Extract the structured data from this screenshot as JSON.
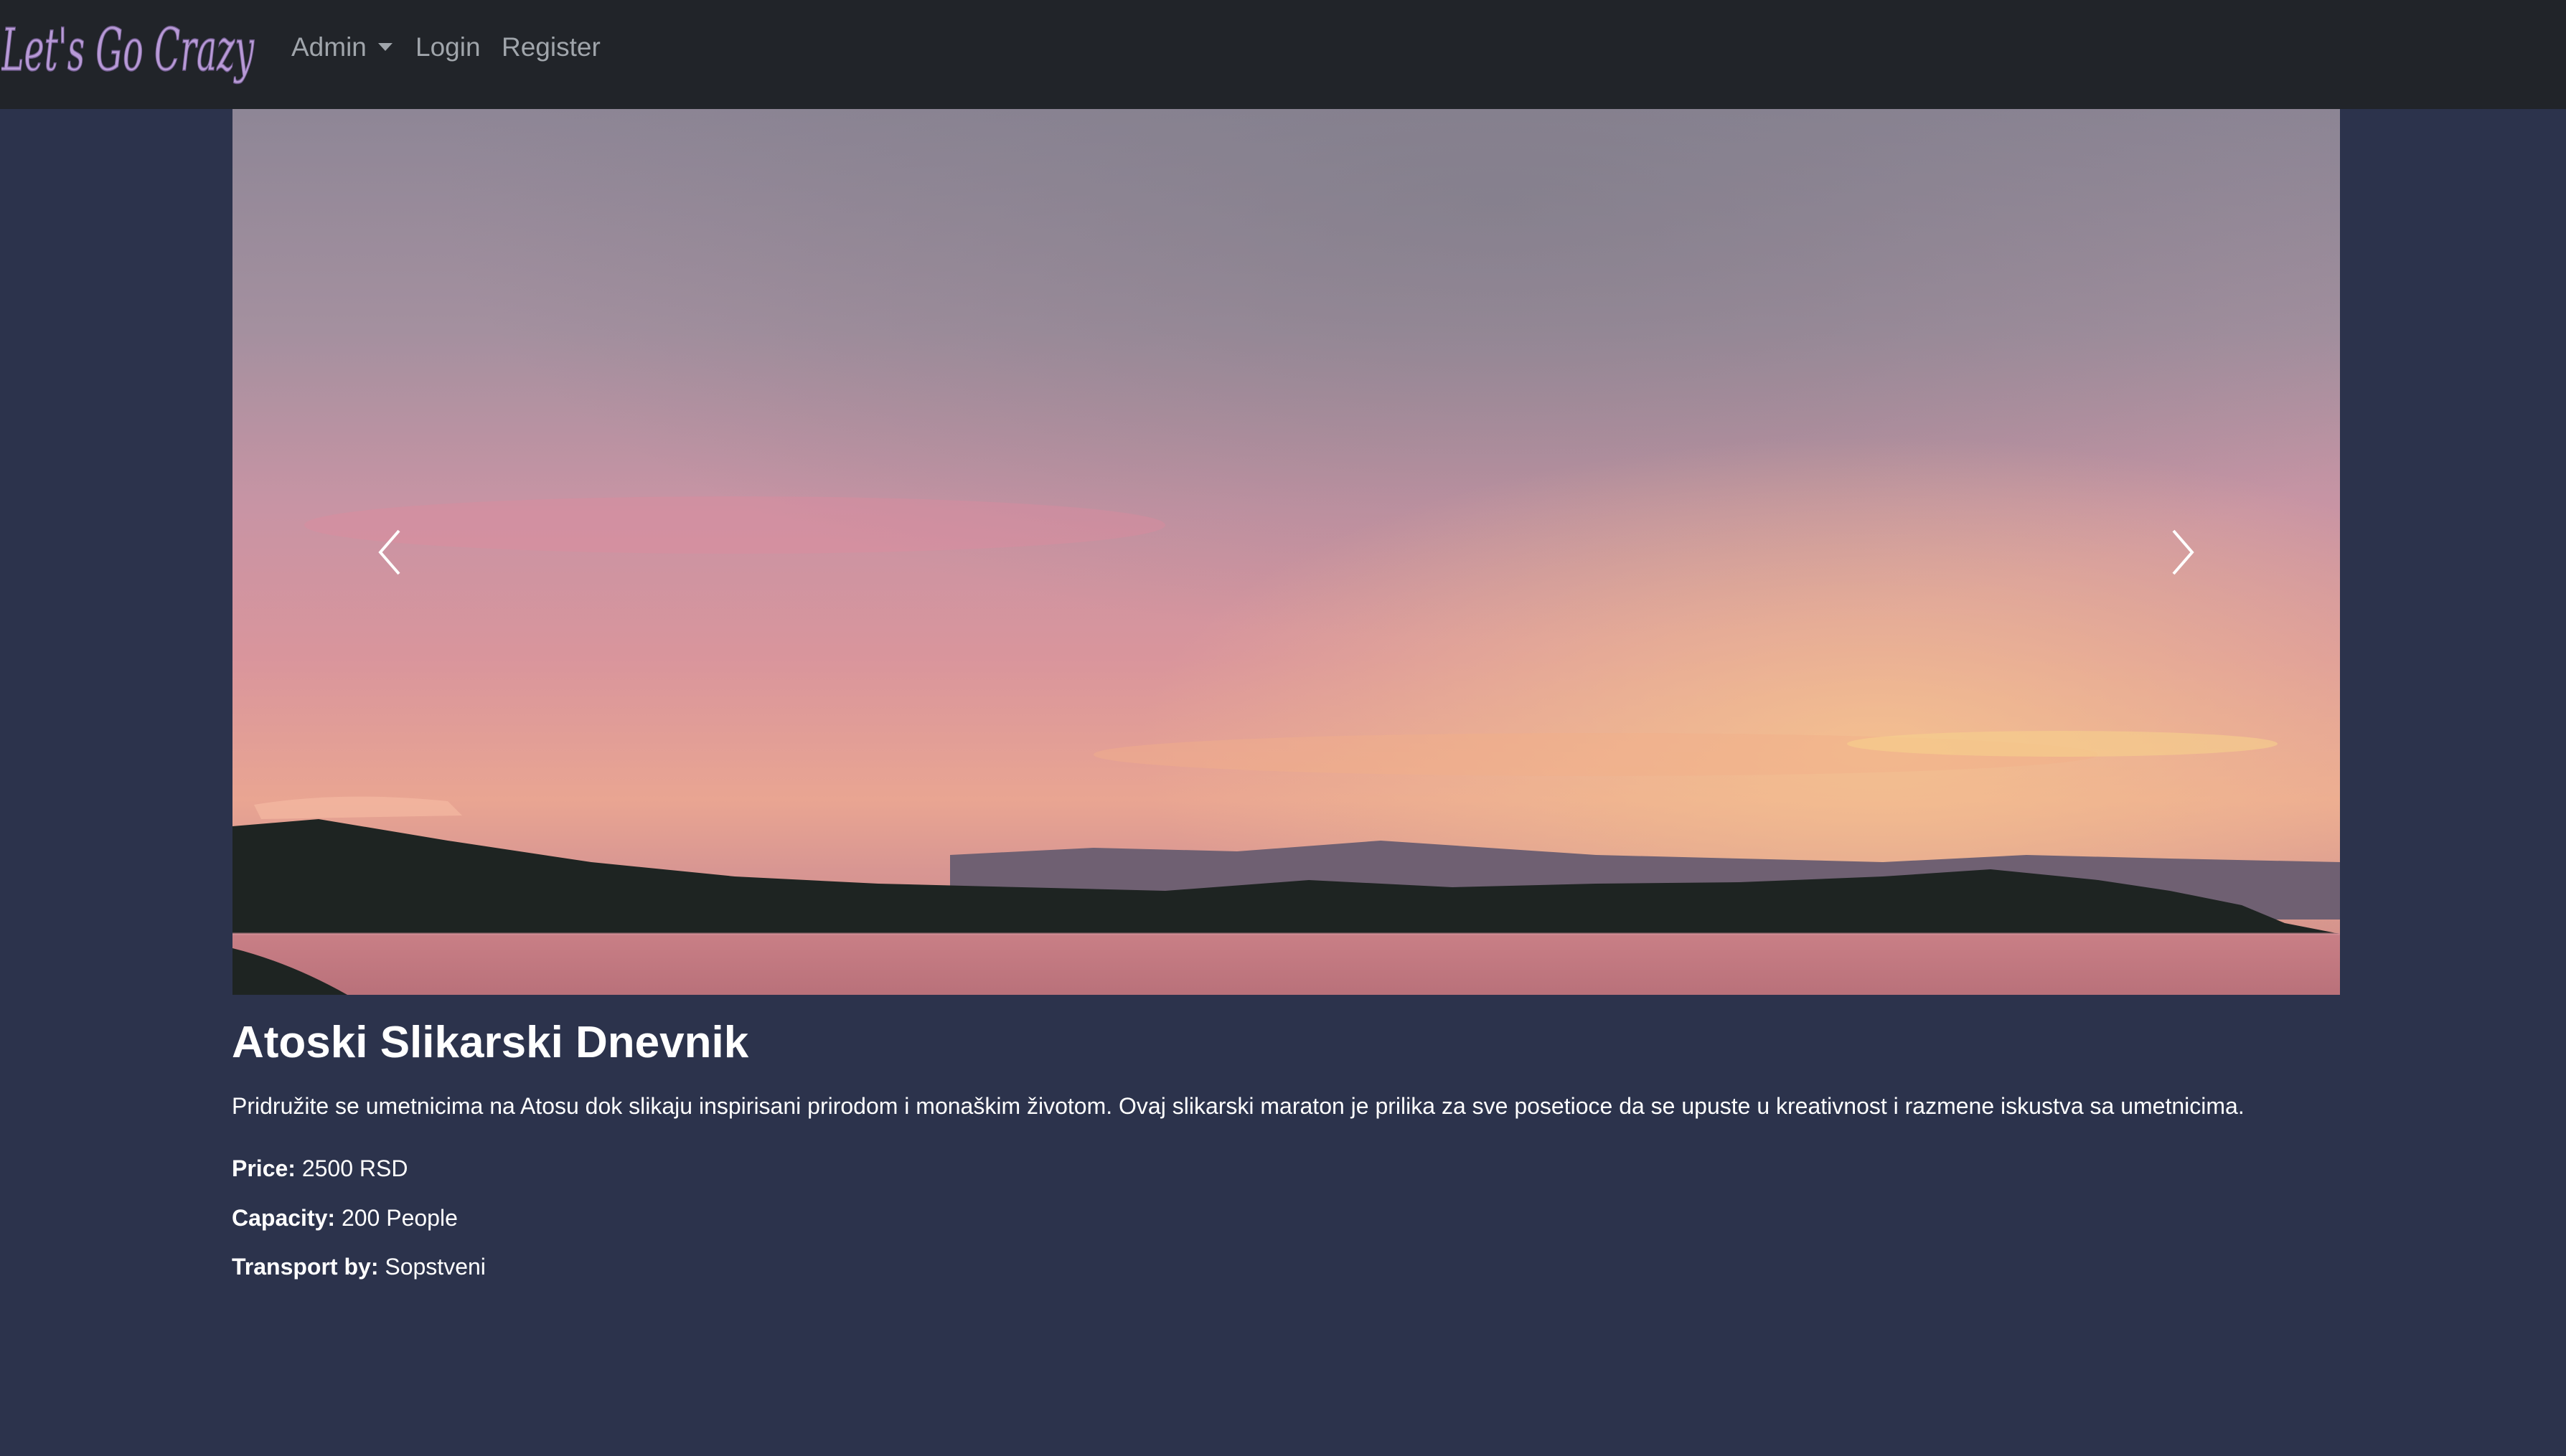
{
  "navbar": {
    "brand": "Let's Go Crazy",
    "items": [
      {
        "label": "Admin",
        "has_dropdown": true
      },
      {
        "label": "Login"
      },
      {
        "label": "Register"
      }
    ]
  },
  "carousel": {
    "image_alt": "Sunset over the sea with hills",
    "prev_icon": "chevron-left-icon",
    "next_icon": "chevron-right-icon"
  },
  "event": {
    "title": "Atoski Slikarski Dnevnik",
    "description": "Pridružite se umetnicima na Atosu dok slikaju inspirisani prirodom i monaškim životom. Ovaj slikarski maraton je prilika za sve posetioce da se upuste u kreativnost i razmene iskustva sa umetnicima.",
    "price_label": "Price:",
    "price_value": "2500 RSD",
    "capacity_label": "Capacity:",
    "capacity_value": "200 People",
    "transport_label": "Transport by:",
    "transport_value": "Sopstveni"
  },
  "colors": {
    "navbar_bg": "#212429",
    "page_bg": "#2c334c",
    "brand": "#b89ad6",
    "nav_link": "#a0a5ab",
    "text": "#ffffff"
  }
}
